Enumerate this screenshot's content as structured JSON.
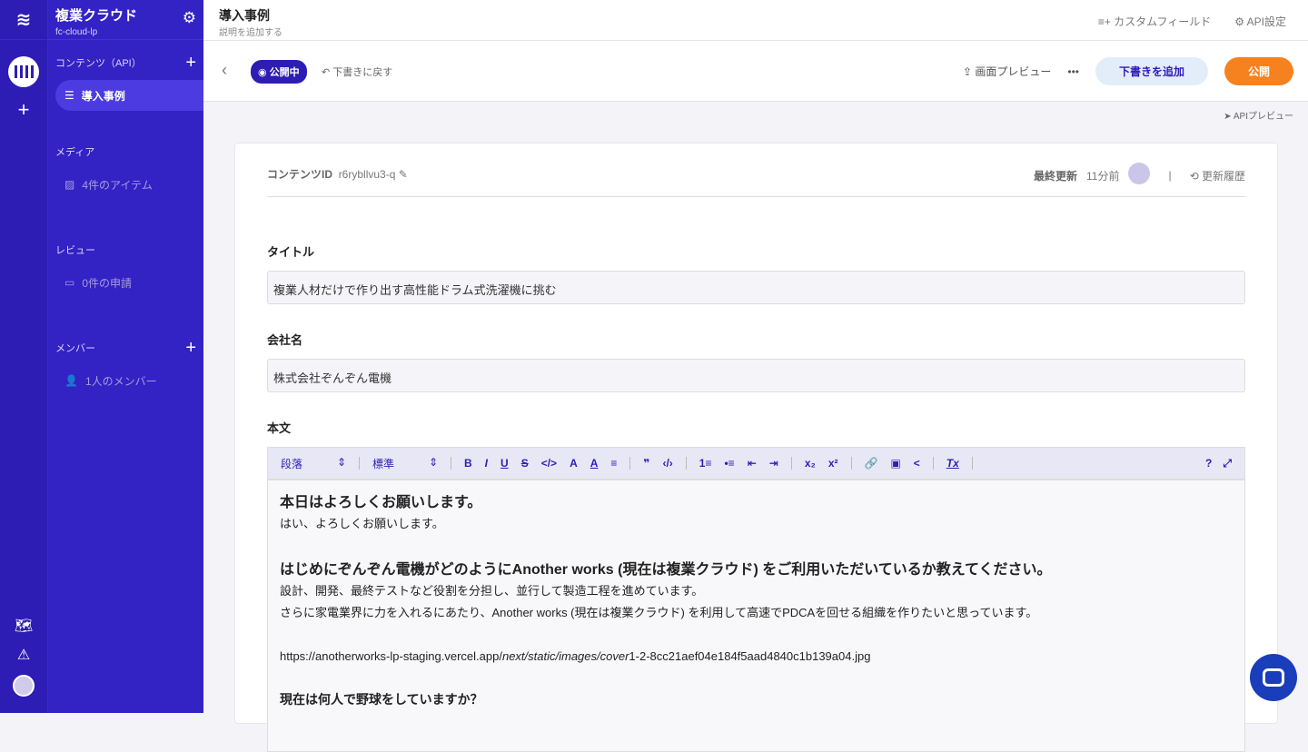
{
  "app": {
    "title": "複業クラウド",
    "service": "fc-cloud-lp"
  },
  "nav": {
    "contents_label": "コンテンツ（API）",
    "contents_item": "導入事例",
    "media_label": "メディア",
    "media_item": "4件のアイテム",
    "review_label": "レビュー",
    "review_item": "0件の申請",
    "member_label": "メンバー",
    "member_item": "1人のメンバー"
  },
  "header": {
    "title": "導入事例",
    "desc": "説明を追加する",
    "custom_fields": "カスタムフィールド",
    "api_settings": "API設定"
  },
  "toolbar": {
    "status": "公開中",
    "revert": "下書きに戻す",
    "preview": "画面プレビュー",
    "more": "•••",
    "add_draft": "下書きを追加",
    "publish": "公開",
    "api_preview": "APIプレビュー"
  },
  "meta": {
    "id_label": "コンテンツID",
    "id_value": "r6rybllvu3-q",
    "updated_label": "最終更新",
    "updated_value": "11分前",
    "separator": "|",
    "history": "更新履歴"
  },
  "fields": {
    "title_label": "タイトル",
    "title_value": "複業人材だけで作り出す高性能ドラム式洗濯機に挑む",
    "company_label": "会社名",
    "company_value": "株式会社ぞんぞん電機",
    "body_label": "本文"
  },
  "editor_toolbar": {
    "block": "段落",
    "size": "標準",
    "buttons": [
      "B",
      "I",
      "U",
      "S",
      "</>",
      "A",
      "A",
      "≡",
      "❞",
      "‹/›",
      "1≡",
      "•≡",
      "⇤",
      "⇥",
      "x₂",
      "x²",
      "🔗",
      "▣",
      "<",
      "Tx"
    ]
  },
  "body": {
    "h1": "本日はよろしくお願いします。",
    "p1": "はい、よろしくお願いします。",
    "h2": "はじめにぞんぞん電機がどのようにAnother works (現在は複業クラウド) をご利用いただいているか教えてください。",
    "p2": "設計、開発、最終テストなど役割を分担し、並行して製造工程を進めています。",
    "p3": "さらに家電業界に力を入れるにあたり、Another works (現在は複業クラウド) を利用して高速でPDCAを回せる組織を作りたいと思っています。",
    "url_a": "https://anotherworks-lp-staging.vercel.app/",
    "url_b": "next/static/images/cover",
    "url_c": "1-2-8cc21aef04e184f5aad4840c1b139a04.jpg",
    "h3": "現在は何人で野球をしていますか？"
  }
}
